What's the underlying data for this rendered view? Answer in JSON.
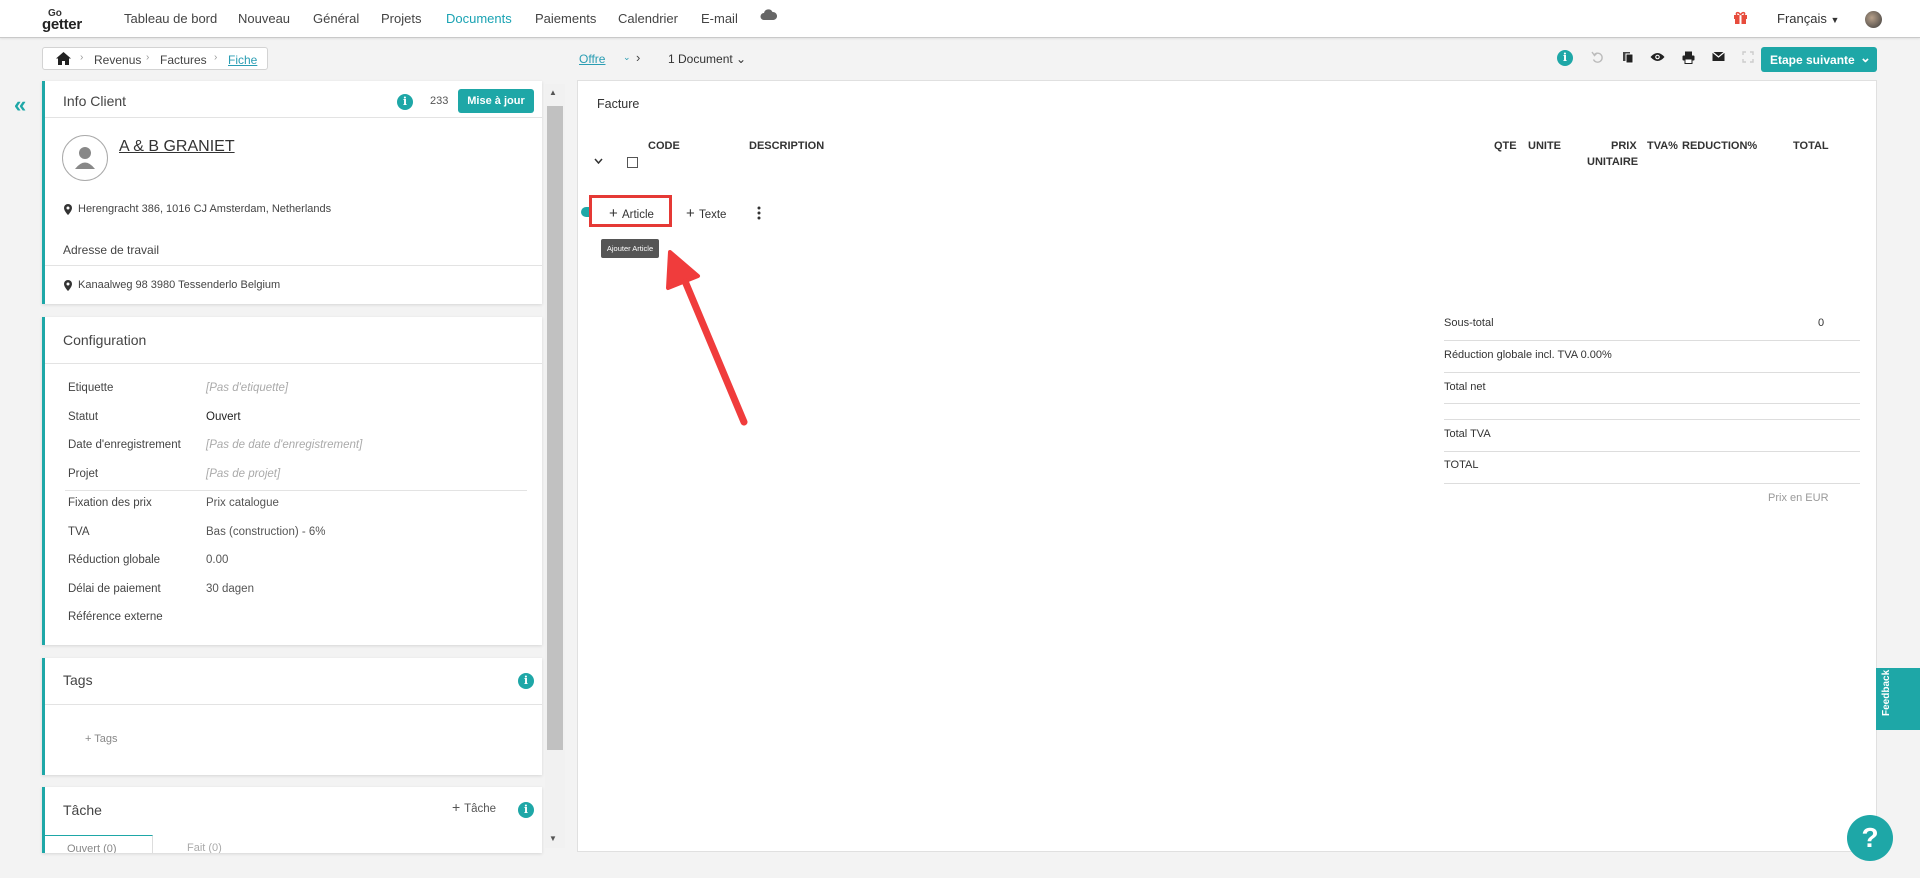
{
  "nav": {
    "logo_top": "Go",
    "logo_bottom": "getter",
    "items": [
      "Tableau de bord",
      "Nouveau",
      "Général",
      "Projets",
      "Documents",
      "Paiements",
      "Calendrier",
      "E-mail"
    ],
    "active": "Documents",
    "language": "Français"
  },
  "breadcrumb": {
    "items": [
      "Revenus",
      "Factures",
      "Fiche"
    ],
    "offre": "Offre",
    "doc_count": "1 Document",
    "next_step": "Etape suivante"
  },
  "client": {
    "title": "Info Client",
    "count": "233",
    "update_label": "Mise à jour",
    "name": "A & B GRANIET",
    "address": "Herengracht 386, 1016 CJ Amsterdam, Netherlands",
    "work_address_label": "Adresse de travail",
    "work_address": "Kanaalweg 98 3980 Tessenderlo Belgium"
  },
  "config": {
    "title": "Configuration",
    "rows": [
      {
        "label": "Etiquette",
        "value": "[Pas d'etiquette]"
      },
      {
        "label": "Statut",
        "value": "Ouvert"
      },
      {
        "label": "Date d'enregistrement",
        "value": "[Pas de date d'enregistrement]"
      },
      {
        "label": "Projet",
        "value": "[Pas de projet]"
      },
      {
        "label": "Fixation des prix",
        "value": "Prix catalogue"
      },
      {
        "label": "TVA",
        "value": "Bas (construction) - 6%"
      },
      {
        "label": "Réduction globale",
        "value": "0.00"
      },
      {
        "label": "Délai de paiement",
        "value": "30 dagen"
      },
      {
        "label": "Référence externe",
        "value": ""
      }
    ]
  },
  "tags": {
    "title": "Tags",
    "add_label": "Tags"
  },
  "tasks": {
    "title": "Tâche",
    "add_label": "Tâche",
    "tab_open": "Ouvert (0)",
    "tab_done": "Fait (0)"
  },
  "invoice": {
    "title": "Facture",
    "columns": {
      "code": "CODE",
      "description": "DESCRIPTION",
      "qty": "QTE",
      "unit": "UNITE",
      "unit_price_1": "PRIX",
      "unit_price_2": "UNITAIRE",
      "vat": "TVA%",
      "reduction": "REDUCTION%",
      "total": "TOTAL"
    },
    "add_article": "Article",
    "add_text": "Texte",
    "tooltip": "Ajouter Article"
  },
  "totals": {
    "subtotal_label": "Sous-total",
    "subtotal_value": "0",
    "global_reduction_label": "Réduction globale incl. TVA 0.00%",
    "net_label": "Total net",
    "vat_label": "Total TVA",
    "total_label": "TOTAL",
    "currency_note": "Prix en EUR"
  },
  "widgets": {
    "feedback": "Feedback",
    "help": "?"
  },
  "colors": {
    "accent": "#1ea7a7",
    "highlight": "#e53935",
    "link": "#2a9db3"
  }
}
